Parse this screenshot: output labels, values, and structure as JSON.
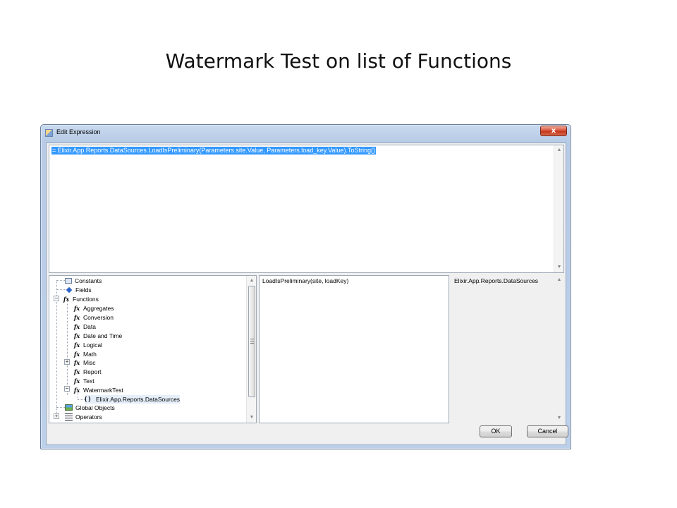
{
  "slide": {
    "title": "Watermark Test on list of Functions"
  },
  "dialog": {
    "title": "Edit Expression",
    "close_glyph": "x",
    "expression": "= Elixir.App.Reports.DataSources.LoadIsPreliminary(Parameters.site.Value, Parameters.load_key.Value).ToString()",
    "tree": {
      "items": [
        {
          "label": "Constants",
          "icon": "constants-icon"
        },
        {
          "label": "Fields",
          "icon": "fields-icon"
        },
        {
          "label": "Functions",
          "icon": "function-icon",
          "expanded": true
        },
        {
          "label": "Aggregates",
          "icon": "function-icon"
        },
        {
          "label": "Conversion",
          "icon": "function-icon"
        },
        {
          "label": "Data",
          "icon": "function-icon"
        },
        {
          "label": "Date and Time",
          "icon": "function-icon"
        },
        {
          "label": "Logical",
          "icon": "function-icon"
        },
        {
          "label": "Math",
          "icon": "function-icon"
        },
        {
          "label": "Misc",
          "icon": "function-icon",
          "expanded": false
        },
        {
          "label": "Report",
          "icon": "function-icon"
        },
        {
          "label": "Text",
          "icon": "function-icon"
        },
        {
          "label": "WatermarkTest",
          "icon": "function-icon",
          "expanded": true
        },
        {
          "label": "Elixir.App.Reports.DataSources",
          "icon": "namespace-icon",
          "selected": true
        },
        {
          "label": "Global Objects",
          "icon": "global-objects-icon"
        },
        {
          "label": "Operators",
          "icon": "operators-icon",
          "expanded": false
        }
      ],
      "fx_glyph": "fx",
      "braces_glyph": "{ }"
    },
    "signature": "LoadIsPreliminary(site, loadKey)",
    "namespace": "Elixir.App.Reports.DataSources",
    "buttons": {
      "ok": "OK",
      "cancel": "Cancel"
    }
  }
}
